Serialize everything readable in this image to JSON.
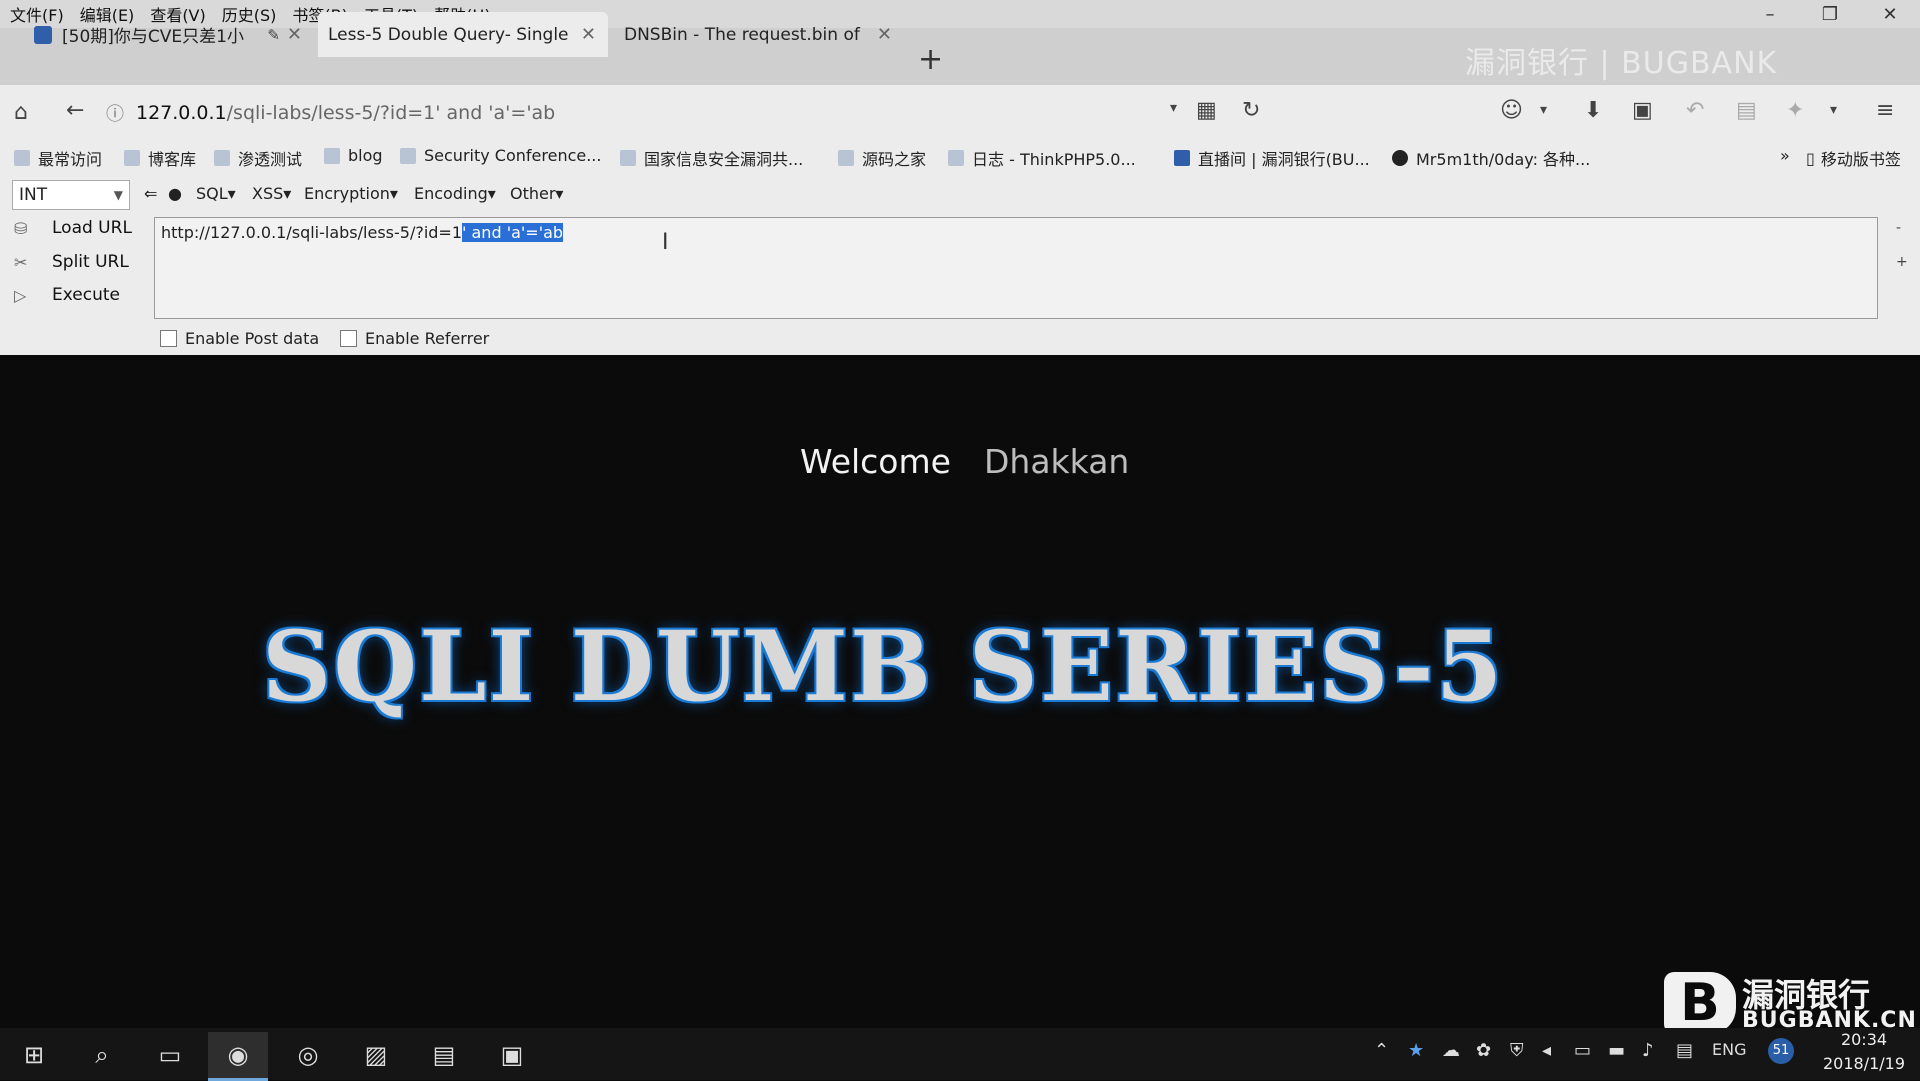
{
  "menu": [
    "文件(F)",
    "编辑(E)",
    "查看(V)",
    "历史(S)",
    "书签(B)",
    "工具(T)",
    "帮助(H)"
  ],
  "tabs": [
    {
      "label": "[50期]你与CVE只差1小"
    },
    {
      "label": "Less-5 Double Query- Single"
    },
    {
      "label": "DNSBin - The request.bin of"
    }
  ],
  "new_tab": "+",
  "brand_top": "漏洞银行 | BUGBANK",
  "address": {
    "host": "127.0.0.1",
    "path": "/sqli-labs/less-5/?id=1' and 'a'='ab"
  },
  "bookmarks": [
    "最常访问",
    "博客库",
    "渗透测试",
    "blog",
    "Security Conference...",
    "国家信息安全漏洞共...",
    "源码之家",
    "日志 - ThinkPHP5.0...",
    "直播间 | 漏洞银行(BU...",
    "Mr5m1th/0day: 各种..."
  ],
  "bookmarks_more": "»",
  "mobile_bookmarks": "移动版书签",
  "hackbar": {
    "select_value": "INT",
    "menus": [
      "SQL▾",
      "XSS▾",
      "Encryption▾",
      "Encoding▾",
      "Other▾"
    ],
    "load_url": "Load URL",
    "split_url": "Split URL",
    "execute": "Execute",
    "url_text_plain": "http://127.0.0.1/sqli-labs/less-5/?id=1",
    "url_text_selected": "' and 'a'='ab",
    "enable_post": "Enable Post data",
    "enable_referrer": "Enable Referrer"
  },
  "page": {
    "welcome": "Welcome",
    "name": "Dhakkan",
    "banner": "SQLI DUMB SERIES-5"
  },
  "watermark": {
    "cn": "漏洞银行",
    "en": "BUGBANK.CN"
  },
  "taskbar": {
    "lang": "ENG",
    "time": "20:34",
    "date": "2018/1/19",
    "badge": "51"
  }
}
